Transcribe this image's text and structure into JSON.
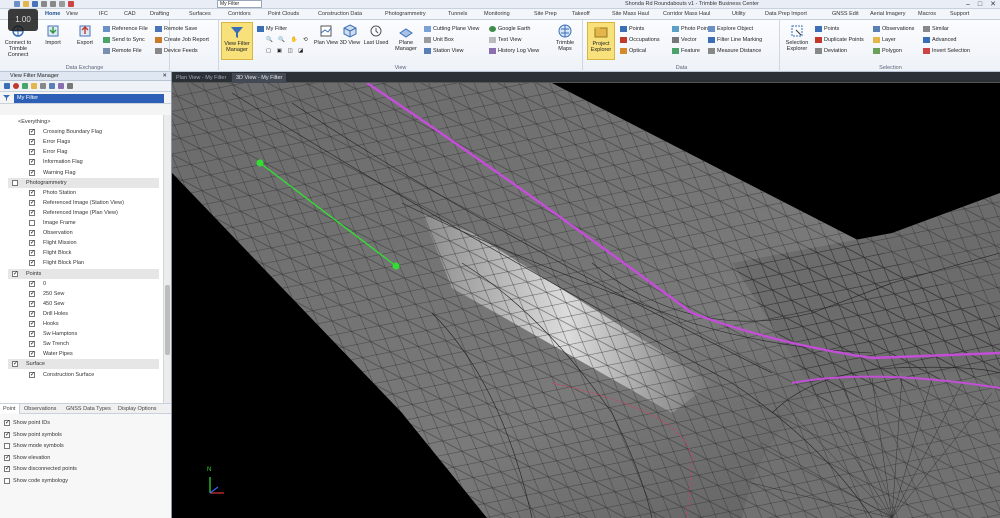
{
  "titlebar": {
    "filter_value": "My Filter",
    "title": "Shonda Rd Roundabouts v1 - Trimble Business Center",
    "win_min": "–",
    "win_max": "□",
    "win_close": "✕"
  },
  "logo": {
    "text": "1.00"
  },
  "tabs": [
    "Home",
    "View",
    "IFC",
    "CAD",
    "Drafting",
    "Surfaces",
    "Corridors",
    "Point Clouds",
    "Construction Data",
    "Photogrammetry",
    "Tunnels",
    "Monitoring",
    "Site Prep",
    "Takeoff",
    "Site Mass Haul",
    "Corridor Mass Haul",
    "Utility",
    "Data Prep Import",
    "GNSS Edit",
    "Aerial Imagery",
    "Macros",
    "Support"
  ],
  "ribbon": {
    "connect_label": "Connect to Trimble Connect",
    "import_label": "Import",
    "export_label": "Export",
    "reference_file": "Reference File",
    "send_to_sync": "Send to Sync",
    "remote_file": "Remote File",
    "remote_save": "Remote Save",
    "create_job_report": "Create Job Report",
    "device_feeds": "Device Feeds",
    "data_exchange": "Data Exchange",
    "view_filter_manager": "View Filter Manager",
    "my_filter": "My Filter",
    "plan_view": "Plan View",
    "three_d_view": "3D View",
    "last_used": "Last Used",
    "plane_manager": "Plane Manager",
    "cutting_plane_view": "Cutting Plane View",
    "unit_box": "Unit Box",
    "station_view": "Station View",
    "google_earth": "Google Earth",
    "text_view": "Text View",
    "history_log_view": "History Log View",
    "trimble_maps": "Trimble Maps",
    "view_group": "View",
    "project_explorer": "Project Explorer",
    "points": "Points",
    "occupations": "Occupations",
    "optical": "Optical",
    "photo_points": "Photo Points",
    "vector": "Vector",
    "feature": "Feature",
    "explore_object": "Explore Object",
    "filter_line_marking": "Filter Line Marking",
    "measure_distance": "Measure Distance",
    "data_group": "Data",
    "selection_explorer": "Selection Explorer",
    "sel_points": "Points",
    "duplicate_points": "Duplicate Points",
    "deviation": "Deviation",
    "observations": "Observations",
    "layer": "Layer",
    "polygon": "Polygon",
    "similar": "Similar",
    "advanced": "Advanced",
    "invert_selection": "Invert Selection",
    "selection_group": "Selection"
  },
  "panel": {
    "title": "View Filter Manager",
    "pin": "✕",
    "filter_name": "My Filter",
    "tree": [
      {
        "kind": "row",
        "label": "<Everything>",
        "indent": 0,
        "checked": null
      },
      {
        "kind": "row",
        "label": "Crossing Boundary Flag",
        "indent": 1,
        "checked": true
      },
      {
        "kind": "row",
        "label": "Error Flags",
        "indent": 1,
        "checked": true
      },
      {
        "kind": "row",
        "label": "Error Flag",
        "indent": 1,
        "checked": true
      },
      {
        "kind": "row",
        "label": "Information Flag",
        "indent": 1,
        "checked": true
      },
      {
        "kind": "row",
        "label": "Warning Flag",
        "indent": 1,
        "checked": true
      },
      {
        "kind": "hdr",
        "label": "Photogrammetry",
        "checked": false
      },
      {
        "kind": "row",
        "label": "Photo Station",
        "indent": 1,
        "checked": true
      },
      {
        "kind": "row",
        "label": "Referenced Image (Station View)",
        "indent": 1,
        "checked": true
      },
      {
        "kind": "row",
        "label": "Referenced Image (Plan View)",
        "indent": 1,
        "checked": true
      },
      {
        "kind": "row",
        "label": "Image Frame",
        "indent": 1,
        "checked": false
      },
      {
        "kind": "row",
        "label": "Observation",
        "indent": 1,
        "checked": true
      },
      {
        "kind": "row",
        "label": "Flight Mission",
        "indent": 1,
        "checked": true
      },
      {
        "kind": "row",
        "label": "Flight Block",
        "indent": 1,
        "checked": true
      },
      {
        "kind": "row",
        "label": "Flight Block Plan",
        "indent": 1,
        "checked": true
      },
      {
        "kind": "hdr",
        "label": "Points",
        "checked": true
      },
      {
        "kind": "row",
        "label": "0",
        "indent": 1,
        "checked": true
      },
      {
        "kind": "row",
        "label": "250 Sew",
        "indent": 1,
        "checked": true
      },
      {
        "kind": "row",
        "label": "450 Sew",
        "indent": 1,
        "checked": true
      },
      {
        "kind": "row",
        "label": "Drill Holes",
        "indent": 1,
        "checked": true
      },
      {
        "kind": "row",
        "label": "Hooks",
        "indent": 1,
        "checked": true
      },
      {
        "kind": "row",
        "label": "Sw Hamptons",
        "indent": 1,
        "checked": true
      },
      {
        "kind": "row",
        "label": "Sw Trench",
        "indent": 1,
        "checked": true
      },
      {
        "kind": "row",
        "label": "Water Pipes",
        "indent": 1,
        "checked": true
      },
      {
        "kind": "hdr",
        "label": "Surface",
        "checked": true
      },
      {
        "kind": "row",
        "label": "Construction Surface",
        "indent": 1,
        "checked": true
      }
    ],
    "bottom_tabs": [
      "Point",
      "Observations",
      "GNSS Data Types",
      "Display Options"
    ],
    "options": [
      {
        "label": "Show point IDs",
        "checked": true
      },
      {
        "label": "Show point symbols",
        "checked": true
      },
      {
        "label": "Show mode symbols",
        "checked": false
      },
      {
        "label": "Show elevation",
        "checked": true
      },
      {
        "label": "Show disconnected points",
        "checked": true
      },
      {
        "label": "Show code symbology",
        "checked": false
      }
    ]
  },
  "viewtabs": [
    "Plan View - My Filter",
    "3D View - My Filter"
  ],
  "viewport": {
    "axis_n": "N"
  },
  "colors": {
    "accent": "#2c5fb5",
    "highlight": "#f8e07a",
    "alignment": "#c24fd6",
    "measure": "#33dd33",
    "surface": "#6a6a6a"
  }
}
